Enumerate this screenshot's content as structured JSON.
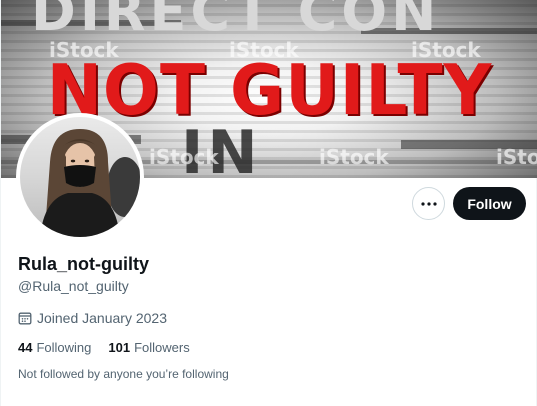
{
  "banner": {
    "headline": "NOT GUILTY",
    "ghost_top": "DIRECT CON",
    "ghost_bottom": "IN",
    "watermark": "iStock"
  },
  "profile": {
    "display_name": "Rula_not-guilty",
    "handle": "@Rula_not_guilty",
    "joined": "Joined January 2023",
    "following_count": "44",
    "following_label": "Following",
    "followers_count": "101",
    "followers_label": "Followers",
    "followed_by": "Not followed by anyone you’re following"
  },
  "actions": {
    "more_icon": "more-horizontal-icon",
    "follow_label": "Follow"
  },
  "colors": {
    "headline_red": "#e11a1a",
    "follow_bg": "#0f1419",
    "secondary_text": "#536471"
  }
}
